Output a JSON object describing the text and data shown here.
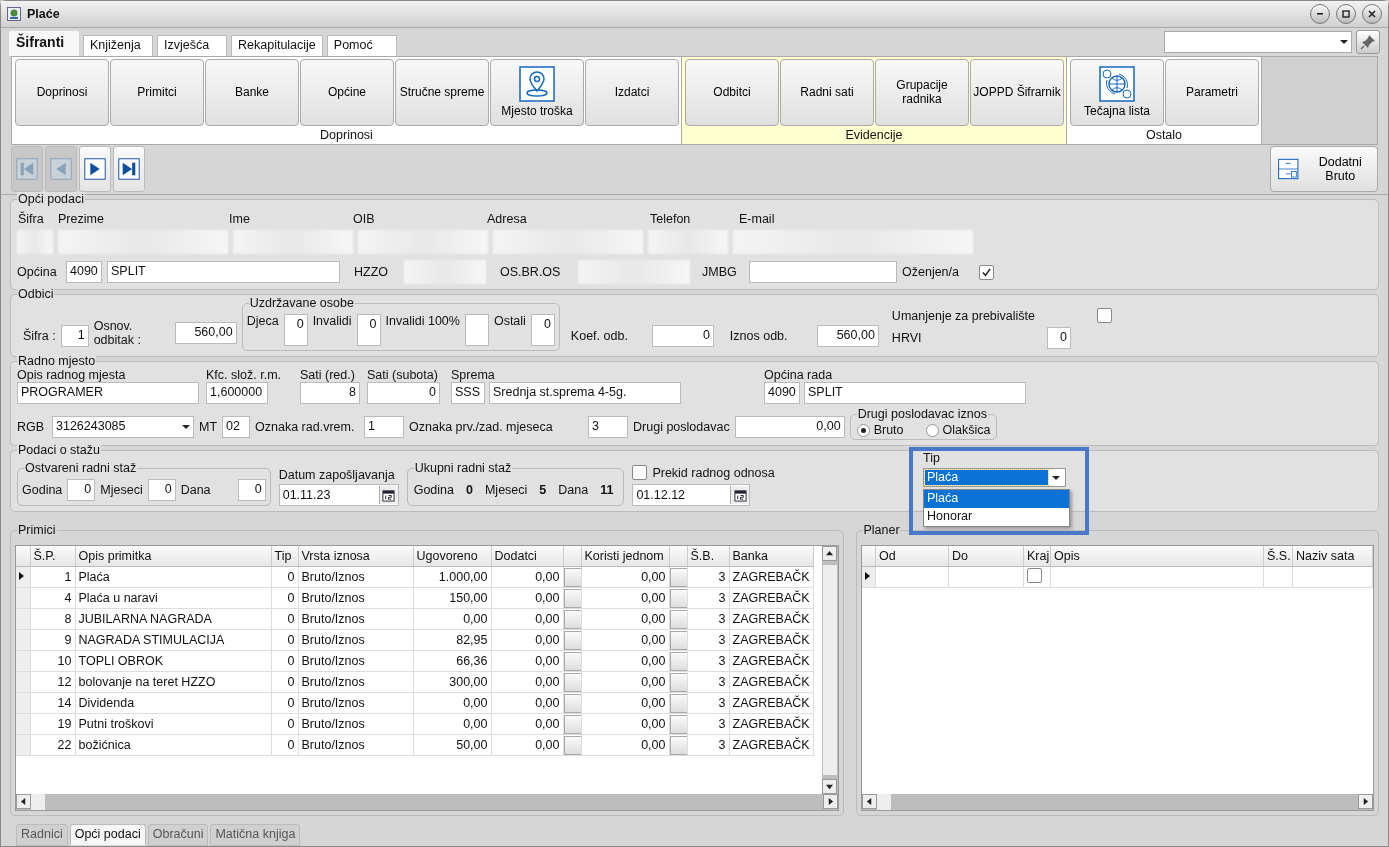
{
  "window": {
    "title": "Plaće"
  },
  "menu_tabs": [
    {
      "label": "Šifranti",
      "selected": true
    },
    {
      "label": "Knjiženja",
      "selected": false
    },
    {
      "label": "Izvješća",
      "selected": false
    },
    {
      "label": "Rekapitulacije",
      "selected": false
    },
    {
      "label": "Pomoć",
      "selected": false
    }
  ],
  "ribbon": {
    "groups": [
      {
        "label": "Doprinosi",
        "highlighted": false,
        "buttons": [
          {
            "label": "Doprinosi",
            "kind": "plain"
          },
          {
            "label": "Primitci",
            "kind": "plain"
          },
          {
            "label": "Banke",
            "kind": "plain"
          },
          {
            "label": "Općine",
            "kind": "plain"
          },
          {
            "label": "Stručne spreme",
            "kind": "plain"
          },
          {
            "label": "Mjesto troška",
            "kind": "location"
          },
          {
            "label": "Izdatci",
            "kind": "plain"
          }
        ]
      },
      {
        "label": "Evidencije",
        "highlighted": true,
        "buttons": [
          {
            "label": "Odbitci",
            "kind": "plain"
          },
          {
            "label": "Radni sati",
            "kind": "plain"
          },
          {
            "label": "Grupacije radnika",
            "kind": "plain"
          },
          {
            "label": "JOPPD Šifrarnik",
            "kind": "plain"
          }
        ]
      },
      {
        "label": "Ostalo",
        "highlighted": false,
        "buttons": [
          {
            "label": "Tečajna lista",
            "kind": "currency"
          },
          {
            "label": "Parametri",
            "kind": "plain"
          }
        ]
      }
    ]
  },
  "navigator": [
    {
      "kind": "first",
      "disabled": true
    },
    {
      "kind": "prev",
      "disabled": true
    },
    {
      "kind": "next",
      "disabled": false
    },
    {
      "kind": "last",
      "disabled": false
    }
  ],
  "extra_button": {
    "label": "Dodatni Bruto"
  },
  "opci_podaci": {
    "title": "Opći podaci",
    "columns": [
      "Šifra",
      "Prezime",
      "Ime",
      "OIB",
      "Adresa",
      "Telefon",
      "E-mail"
    ],
    "opcina": {
      "label": "Općina",
      "code": "4090",
      "name": "SPLIT"
    },
    "hzzo": {
      "label": "HZZO"
    },
    "os_br_os": {
      "label": "OS.BR.OS"
    },
    "jmbg": {
      "label": "JMBG"
    },
    "married": {
      "label": "Oženjen/a",
      "checked": true
    }
  },
  "odbici": {
    "title": "Odbici",
    "sifra": {
      "label": "Šifra :",
      "value": "1"
    },
    "osnovni": {
      "label": "Osnov. odbitak :",
      "value": "560,00"
    },
    "uzdrzavane": {
      "title": "Uzdržavane osobe",
      "items": [
        {
          "label": "Djeca",
          "value": "0"
        },
        {
          "label": "Invalidi",
          "value": "0"
        },
        {
          "label": "Invalidi 100%"
        },
        {
          "label": "Ostali",
          "value": "0"
        }
      ]
    },
    "koef": {
      "label": "Koef. odb.",
      "value": "0"
    },
    "iznos": {
      "label": "Iznos odb.",
      "value": "560,00"
    },
    "umanjenje": {
      "label": "Umanjenje za prebivalište",
      "checked": false
    },
    "hrvi": {
      "label": "HRVI",
      "value": "0"
    }
  },
  "radno_mjesto": {
    "title": "Radno mjesto",
    "opis": {
      "label": "Opis radnog mjesta",
      "value": "PROGRAMER"
    },
    "kfc": {
      "label": "Kfc. slož. r.m.",
      "value": "1,600000"
    },
    "sati_red": {
      "label": "Sati (red.)",
      "value": "8"
    },
    "sati_sub": {
      "label": "Sati (subota)",
      "value": "0"
    },
    "sprema": {
      "label": "Sprema",
      "code": "SSS",
      "name": "Srednja st.sprema 4-5g."
    },
    "opcina_rada": {
      "label": "Općina rada",
      "code": "4090",
      "name": "SPLIT"
    },
    "rgb": {
      "label": "RGB",
      "value": "3126243085"
    },
    "mt": {
      "label": "MT",
      "value": "02"
    },
    "oznaka_rad": {
      "label": "Oznaka rad.vrem.",
      "value": "1"
    },
    "oznaka_prv": {
      "label": "Oznaka prv./zad. mjeseca",
      "value": "3"
    },
    "drugi": {
      "label": "Drugi poslodavac",
      "value": "0,00"
    },
    "drugi_iznos": {
      "title": "Drugi poslodavac iznos",
      "options": [
        {
          "label": "Bruto",
          "selected": true
        },
        {
          "label": "Olakšica",
          "selected": false
        }
      ]
    }
  },
  "staz": {
    "title": "Podaci o stažu",
    "ostvareni": {
      "title": "Ostvareni radni staž",
      "items": [
        {
          "label": "Godina",
          "value": "0"
        },
        {
          "label": "Mjeseci",
          "value": "0"
        },
        {
          "label": "Dana",
          "value": "0"
        }
      ]
    },
    "datum": {
      "label": "Datum zapošljavanja",
      "value": "01.11.23"
    },
    "ukupni": {
      "title": "Ukupni radni staž",
      "items": [
        {
          "label": "Godina",
          "value": "0"
        },
        {
          "label": "Mjeseci",
          "value": "5"
        },
        {
          "label": "Dana",
          "value": "11"
        }
      ]
    },
    "prekid": {
      "label": "Prekid radnog odnosa",
      "checked": false,
      "date": "01.12.12"
    },
    "tip": {
      "label": "Tip",
      "value": "Plaća",
      "expanded": true,
      "options": [
        {
          "label": "Plaća",
          "selected": true
        },
        {
          "label": "Honorar",
          "selected": false
        }
      ]
    }
  },
  "primici": {
    "title": "Primici",
    "columns": [
      "Š.P.",
      "Opis primitka",
      "Tip",
      "Vrsta iznosa",
      "Ugovoreno",
      "Dodatci",
      "Koristi jednom",
      "Š.B.",
      "Banka"
    ],
    "rows": [
      {
        "current": true,
        "cells": [
          "1",
          "Plaća",
          "0",
          "Bruto/Iznos",
          "1.000,00",
          "0,00",
          "0,00",
          "3",
          "ZAGREBAČK"
        ]
      },
      {
        "current": false,
        "cells": [
          "4",
          "Plaća u naravi",
          "0",
          "Bruto/Iznos",
          "150,00",
          "0,00",
          "0,00",
          "3",
          "ZAGREBAČK"
        ]
      },
      {
        "current": false,
        "cells": [
          "8",
          "JUBILARNA NAGRADA",
          "0",
          "Bruto/Iznos",
          "0,00",
          "0,00",
          "0,00",
          "3",
          "ZAGREBAČK"
        ]
      },
      {
        "current": false,
        "cells": [
          "9",
          "NAGRADA STIMULACIJA",
          "0",
          "Bruto/Iznos",
          "82,95",
          "0,00",
          "0,00",
          "3",
          "ZAGREBAČK"
        ]
      },
      {
        "current": false,
        "cells": [
          "10",
          "TOPLI OBROK",
          "0",
          "Bruto/Iznos",
          "66,36",
          "0,00",
          "0,00",
          "3",
          "ZAGREBAČK"
        ]
      },
      {
        "current": false,
        "cells": [
          "12",
          "bolovanje na teret HZZO",
          "0",
          "Bruto/Iznos",
          "300,00",
          "0,00",
          "0,00",
          "3",
          "ZAGREBAČK"
        ]
      },
      {
        "current": false,
        "cells": [
          "14",
          "Dividenda",
          "0",
          "Bruto/Iznos",
          "0,00",
          "0,00",
          "0,00",
          "3",
          "ZAGREBAČK"
        ]
      },
      {
        "current": false,
        "cells": [
          "19",
          "Putni troškovi",
          "0",
          "Bruto/Iznos",
          "0,00",
          "0,00",
          "0,00",
          "3",
          "ZAGREBAČK"
        ]
      },
      {
        "current": false,
        "cells": [
          "22",
          "božićnica",
          "0",
          "Bruto/Iznos",
          "50,00",
          "0,00",
          "0,00",
          "3",
          "ZAGREBAČK"
        ]
      }
    ]
  },
  "planer": {
    "title": "Planer",
    "columns": [
      "Od",
      "Do",
      "Kraj",
      "Opis",
      "Š.S.",
      "Naziv sata"
    ],
    "rows": [
      {
        "current": true,
        "kraj_checked": false
      }
    ]
  },
  "bottom_tabs": [
    {
      "label": "Radnici",
      "selected": false
    },
    {
      "label": "Opći podaci",
      "selected": true
    },
    {
      "label": "Obračuni",
      "selected": false
    },
    {
      "label": "Matična knjiga",
      "selected": false
    }
  ]
}
